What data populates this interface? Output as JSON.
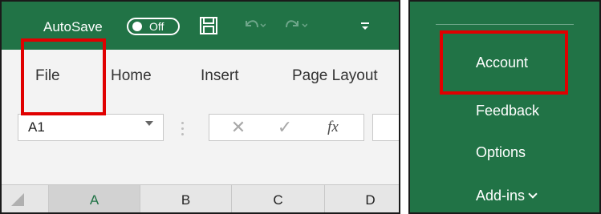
{
  "left_panel": {
    "quick_access": {
      "autosave_label": "AutoSave",
      "autosave_state": "Off",
      "icons": [
        "save-icon",
        "undo-icon",
        "redo-icon",
        "customize-qat-icon"
      ]
    },
    "ribbon_tabs": [
      "File",
      "Home",
      "Insert",
      "Page Layout"
    ],
    "name_box": {
      "value": "A1"
    },
    "formula_buttons": {
      "cancel": "✕",
      "enter": "✓",
      "insert_function": "fx"
    },
    "columns": [
      "A",
      "B",
      "C",
      "D"
    ],
    "selected_column": "A",
    "highlight": "File"
  },
  "right_panel": {
    "menu_items": [
      {
        "label": "Account"
      },
      {
        "label": "Feedback"
      },
      {
        "label": "Options"
      },
      {
        "label": "Add-ins"
      }
    ],
    "highlight": "Account"
  },
  "colors": {
    "excel_green": "#217346",
    "highlight_red": "#e00000",
    "ribbon_bg": "#f3f3f3"
  }
}
